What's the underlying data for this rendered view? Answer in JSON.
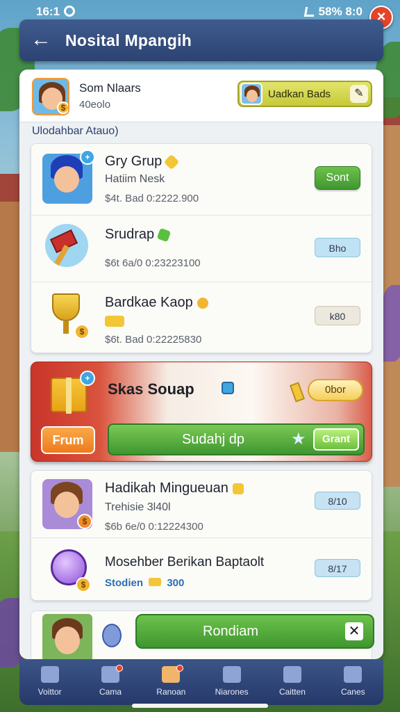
{
  "status_bar": {
    "time": "16:1",
    "right_text": "58% 8:0"
  },
  "header": {
    "title": "Nosital Mpangih"
  },
  "profile": {
    "name": "Som Nlaars",
    "subtitle": "40eolo",
    "pill_label": "Uadkan Bads"
  },
  "section_label": "Ulodahbar Atauo)",
  "list_one": [
    {
      "title": "Gry Grup",
      "subtitle": "Hatiim Nesk",
      "meta": "$4t. Bad 0:2222.900",
      "action": "Sont",
      "action_style": "button"
    },
    {
      "title": "Srudrap",
      "subtitle": "",
      "meta": "$6t 6a/0 0:23223100",
      "action": "Bho",
      "action_style": "chip-blue"
    },
    {
      "title": "Bardkae Kaop",
      "subtitle": "",
      "meta": "$6t. Bad 0:22225830",
      "action": "k80",
      "action_style": "chip-gray"
    }
  ],
  "promo": {
    "title": "Skas Souap",
    "offer_label": "0bor",
    "trade_label": "Frum",
    "bar_label": "Sudahj dp",
    "grant_label": "Grant"
  },
  "list_two": [
    {
      "title": "Hadikah Mingueuan",
      "subtitle": "Trehisie 3l40l",
      "meta": "$6b 6e/0 0:12224300",
      "action": "8/10",
      "action_style": "chip-blue"
    },
    {
      "title": "Mosehber Berikan Baptaolt",
      "subtitle": "",
      "meta": "Stodien",
      "meta_value": "300",
      "action": "8/17",
      "action_style": "chip-blue"
    }
  ],
  "banner": {
    "redeem_label": "Rondiam"
  },
  "bottom_nav": [
    {
      "label": "Voittor",
      "active": false,
      "dot": false
    },
    {
      "label": "Cama",
      "active": false,
      "dot": true
    },
    {
      "label": "Ranoan",
      "active": true,
      "dot": true
    },
    {
      "label": "Niarones",
      "active": false,
      "dot": false
    },
    {
      "label": "Caitten",
      "active": false,
      "dot": false
    },
    {
      "label": "Canes",
      "active": false,
      "dot": false
    }
  ],
  "colors": {
    "header": "#2c4372",
    "accent_green": "#3f9630",
    "promo_red": "#c9352a",
    "offer_gold": "#f6cf5a",
    "close_red": "#e2452b"
  },
  "icons": [
    "back-arrow-icon",
    "close-icon",
    "edit-pencil-icon",
    "star-icon",
    "gift-icon",
    "x-icon"
  ]
}
